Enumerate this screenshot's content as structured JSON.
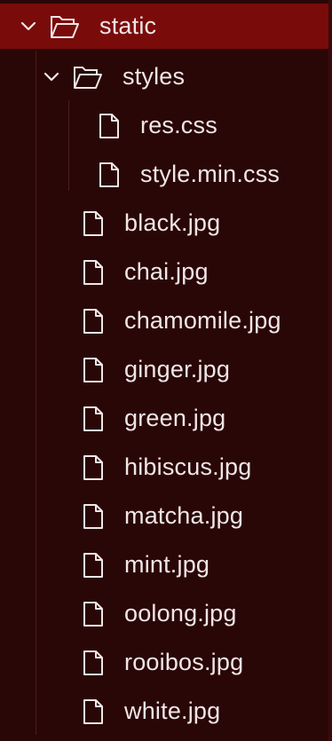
{
  "explorer": {
    "root": {
      "label": "static",
      "expanded": true,
      "icon": "folder-open-icon",
      "selected": true
    },
    "styles_folder": {
      "label": "styles",
      "expanded": true,
      "icon": "folder-open-icon"
    },
    "style_files": [
      {
        "label": "res.css",
        "icon": "file-icon"
      },
      {
        "label": "style.min.css",
        "icon": "file-icon"
      }
    ],
    "files": [
      {
        "label": "black.jpg",
        "icon": "file-icon"
      },
      {
        "label": "chai.jpg",
        "icon": "file-icon"
      },
      {
        "label": "chamomile.jpg",
        "icon": "file-icon"
      },
      {
        "label": "ginger.jpg",
        "icon": "file-icon"
      },
      {
        "label": "green.jpg",
        "icon": "file-icon"
      },
      {
        "label": "hibiscus.jpg",
        "icon": "file-icon"
      },
      {
        "label": "matcha.jpg",
        "icon": "file-icon"
      },
      {
        "label": "mint.jpg",
        "icon": "file-icon"
      },
      {
        "label": "oolong.jpg",
        "icon": "file-icon"
      },
      {
        "label": "rooibos.jpg",
        "icon": "file-icon"
      },
      {
        "label": "white.jpg",
        "icon": "file-icon"
      }
    ]
  },
  "colors": {
    "background": "#2a0707",
    "selected_row": "#7a0b0b",
    "text": "#f1e6e6",
    "guide": "#4a1e1e"
  }
}
